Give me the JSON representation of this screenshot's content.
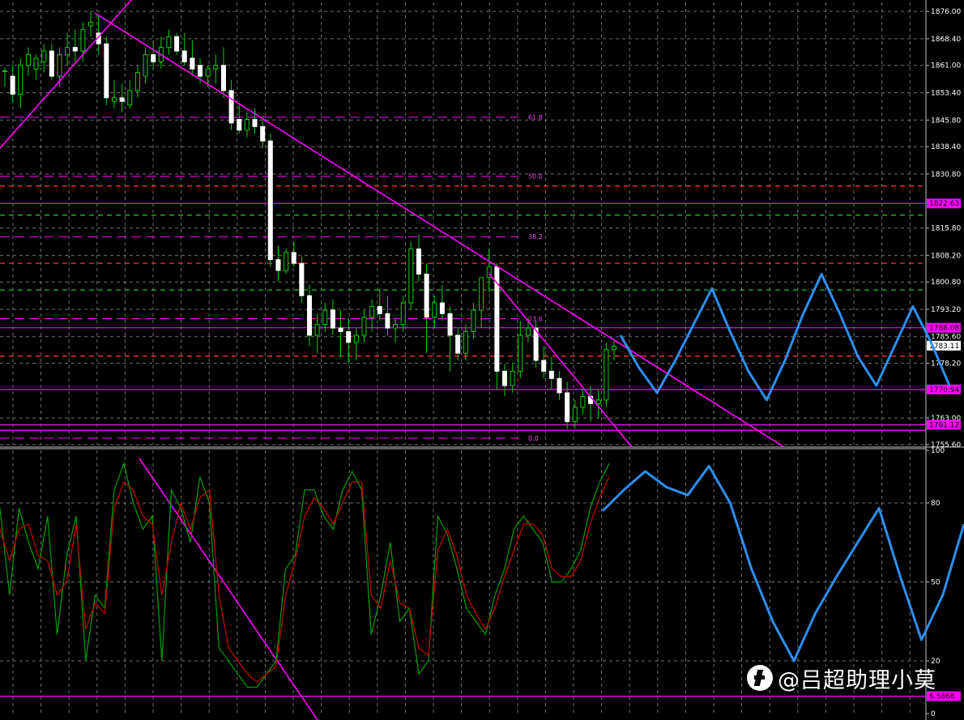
{
  "chart_data": [
    {
      "panel": "price",
      "type": "candlestick",
      "ylim": [
        1755.6,
        1878.5
      ],
      "price_axis_labels": [
        "1876.00",
        "1868.40",
        "1861.00",
        "1853.40",
        "1845.80",
        "1838.40",
        "1830.80",
        "1815.80",
        "1808.20",
        "1800.80",
        "1793.20",
        "1785.60",
        "1778.20",
        "1763.00",
        "1755.60"
      ],
      "highlighted_levels": [
        {
          "label": "1822.63",
          "value": 1822.63,
          "color": "#ff00ff"
        },
        {
          "label": "1788.08",
          "value": 1788.08,
          "color": "#ff00ff"
        },
        {
          "label": "1770.94",
          "value": 1770.94,
          "color": "#ff00ff"
        },
        {
          "label": "1761.12",
          "value": 1761.12,
          "color": "#ff00ff"
        },
        {
          "label": "1783.11",
          "value": 1783.11,
          "color": "#ffffff"
        }
      ],
      "fib_labels": [
        {
          "label": "61.8",
          "value": 1846.6
        },
        {
          "label": "50.0",
          "value": 1830.2
        },
        {
          "label": "38.2",
          "value": 1813.4
        },
        {
          "label": "23.6",
          "value": 1790.6
        },
        {
          "label": "0.0",
          "value": 1757.4
        }
      ],
      "candles": [
        [
          1859.5,
          1860.5,
          1855,
          1859.5
        ],
        [
          1858,
          1861,
          1851,
          1853
        ],
        [
          1853,
          1863,
          1849,
          1861
        ],
        [
          1861,
          1866,
          1858,
          1864
        ],
        [
          1860,
          1864,
          1857,
          1863
        ],
        [
          1862,
          1867,
          1859,
          1865
        ],
        [
          1865,
          1867,
          1857,
          1858
        ],
        [
          1858,
          1866,
          1855,
          1864
        ],
        [
          1864,
          1870,
          1861,
          1866
        ],
        [
          1866,
          1871,
          1862,
          1865
        ],
        [
          1865,
          1873,
          1862,
          1871
        ],
        [
          1872,
          1876,
          1869,
          1873
        ],
        [
          1870,
          1875,
          1864,
          1867
        ],
        [
          1867,
          1869,
          1850,
          1852
        ],
        [
          1851,
          1857,
          1849,
          1852
        ],
        [
          1852,
          1856,
          1848,
          1851
        ],
        [
          1850,
          1857,
          1849,
          1854
        ],
        [
          1854,
          1861,
          1852,
          1859
        ],
        [
          1858,
          1866,
          1856,
          1864
        ],
        [
          1864,
          1868,
          1860,
          1862
        ],
        [
          1862,
          1869,
          1860,
          1866
        ],
        [
          1866,
          1871,
          1864,
          1869
        ],
        [
          1869,
          1870,
          1864,
          1865
        ],
        [
          1865,
          1870,
          1861,
          1862
        ],
        [
          1863,
          1868,
          1858,
          1860
        ],
        [
          1861,
          1863,
          1856,
          1858
        ],
        [
          1858,
          1861,
          1855,
          1860
        ],
        [
          1860,
          1864,
          1856,
          1861
        ],
        [
          1861,
          1866,
          1852,
          1854
        ],
        [
          1854,
          1857,
          1843,
          1845
        ],
        [
          1846,
          1850,
          1842,
          1843
        ],
        [
          1843,
          1848,
          1841,
          1846
        ],
        [
          1846,
          1849,
          1842,
          1844
        ],
        [
          1844,
          1847,
          1838,
          1840
        ],
        [
          1840,
          1842,
          1805,
          1807
        ],
        [
          1807,
          1811,
          1801,
          1804
        ],
        [
          1804,
          1810,
          1803,
          1809
        ],
        [
          1809,
          1812,
          1805,
          1806
        ],
        [
          1806,
          1808,
          1795,
          1797
        ],
        [
          1797,
          1800,
          1783,
          1786
        ],
        [
          1786,
          1792,
          1781,
          1789
        ],
        [
          1789,
          1795,
          1787,
          1793
        ],
        [
          1793,
          1796,
          1786,
          1788
        ],
        [
          1788,
          1793,
          1780,
          1787
        ],
        [
          1787,
          1791,
          1778,
          1784
        ],
        [
          1784,
          1788,
          1779,
          1786
        ],
        [
          1786,
          1793,
          1784,
          1791
        ],
        [
          1791,
          1796,
          1787,
          1794
        ],
        [
          1794,
          1799,
          1790,
          1792
        ],
        [
          1792,
          1797,
          1786,
          1788
        ],
        [
          1788,
          1791,
          1784,
          1789
        ],
        [
          1789,
          1797,
          1787,
          1795
        ],
        [
          1795,
          1812,
          1793,
          1810
        ],
        [
          1810,
          1814,
          1801,
          1803
        ],
        [
          1803,
          1806,
          1781,
          1791
        ],
        [
          1791,
          1797,
          1788,
          1795
        ],
        [
          1795,
          1800,
          1790,
          1792
        ],
        [
          1792,
          1794,
          1776,
          1786
        ],
        [
          1786,
          1788,
          1779,
          1781
        ],
        [
          1781,
          1789,
          1779,
          1787
        ],
        [
          1787,
          1795,
          1785,
          1793
        ],
        [
          1793,
          1798,
          1788,
          1802
        ],
        [
          1802,
          1810,
          1798,
          1805
        ],
        [
          1805,
          1806,
          1771,
          1776
        ],
        [
          1776,
          1778,
          1769,
          1772
        ],
        [
          1772,
          1778,
          1770,
          1776
        ],
        [
          1776,
          1790,
          1774,
          1786
        ],
        [
          1786,
          1791,
          1784,
          1788
        ],
        [
          1788,
          1790,
          1777,
          1779
        ],
        [
          1779,
          1783,
          1774,
          1776
        ],
        [
          1776,
          1780,
          1771,
          1774
        ],
        [
          1774,
          1776,
          1768,
          1770
        ],
        [
          1770,
          1773,
          1760,
          1762
        ],
        [
          1762,
          1768,
          1760,
          1766
        ],
        [
          1766,
          1771,
          1764,
          1769
        ],
        [
          1769,
          1772,
          1762,
          1767
        ],
        [
          1767,
          1771,
          1763,
          1768
        ],
        [
          1768,
          1784,
          1766,
          1782
        ],
        [
          1782,
          1785,
          1779,
          1783
        ]
      ],
      "forecast_path": [
        1786,
        1777,
        1770,
        1779,
        1789,
        1799,
        1787,
        1776,
        1768,
        1779,
        1792,
        1803,
        1792,
        1780,
        1772,
        1783,
        1794,
        1784,
        1772
      ],
      "trendlines": "magenta"
    },
    {
      "panel": "oscillator",
      "type": "line",
      "ylim": [
        0,
        100
      ],
      "axis_labels": [
        "100",
        "80",
        "50",
        "20",
        "0"
      ],
      "highlighted_level": {
        "label": "6.5868",
        "value": 6.5868
      },
      "series": [
        {
          "color": "#00a000",
          "values": [
            78,
            45,
            78,
            65,
            55,
            75,
            30,
            60,
            75,
            20,
            45,
            40,
            85,
            95,
            80,
            70,
            75,
            20,
            85,
            78,
            65,
            90,
            80,
            25,
            20,
            15,
            10,
            10,
            15,
            20,
            55,
            60,
            85,
            85,
            75,
            70,
            85,
            92,
            85,
            30,
            45,
            65,
            35,
            40,
            15,
            20,
            75,
            68,
            55,
            40,
            35,
            30,
            45,
            55,
            70,
            75,
            70,
            65,
            50,
            50,
            55,
            62,
            78,
            88,
            95
          ]
        },
        {
          "color": "#cc0000",
          "values": [
            70,
            58,
            70,
            72,
            60,
            58,
            45,
            50,
            72,
            32,
            42,
            38,
            78,
            88,
            85,
            75,
            72,
            45,
            65,
            80,
            70,
            82,
            85,
            45,
            25,
            20,
            15,
            12,
            15,
            18,
            45,
            58,
            75,
            82,
            78,
            72,
            80,
            88,
            88,
            45,
            40,
            58,
            42,
            40,
            25,
            22,
            62,
            70,
            60,
            45,
            38,
            32,
            40,
            52,
            62,
            72,
            72,
            68,
            55,
            52,
            52,
            58,
            72,
            82,
            90
          ]
        }
      ],
      "forecast_path": [
        77,
        85,
        92,
        86,
        83,
        94,
        80,
        55,
        35,
        20,
        38,
        52,
        65,
        78,
        52,
        28,
        45,
        72
      ]
    }
  ],
  "watermark": "@吕超助理小莫"
}
